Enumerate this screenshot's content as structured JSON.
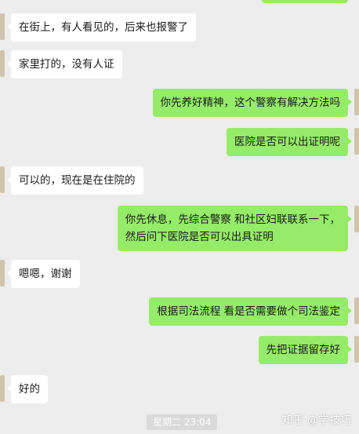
{
  "messages": [
    {
      "side": "in",
      "text": "在街上，有人看见的，后来也报警了"
    },
    {
      "side": "in",
      "text": "家里打的，没有人证"
    },
    {
      "side": "out",
      "text": "你先养好精神，这个警察有解决方法吗"
    },
    {
      "side": "out",
      "text": "医院是否可以出证明呢"
    },
    {
      "side": "in",
      "text": "可以的，现在是在住院的"
    },
    {
      "side": "out",
      "lines": [
        "你先休息，先综合警察 和社区妇联联系一下，",
        "然后问下医院是否可以出具证明"
      ]
    },
    {
      "side": "in",
      "text": "嗯嗯，谢谢"
    },
    {
      "side": "out",
      "text": "根据司法流程 看是否需要做个司法鉴定"
    },
    {
      "side": "out",
      "text": "先把证据留存好"
    },
    {
      "side": "in",
      "text": "好的"
    }
  ],
  "timestamp": "星期二 23:04",
  "watermark": "知乎 @学技巧",
  "colors": {
    "background": "#ededed",
    "outgoing": "#95ec69",
    "incoming": "#ffffff"
  }
}
